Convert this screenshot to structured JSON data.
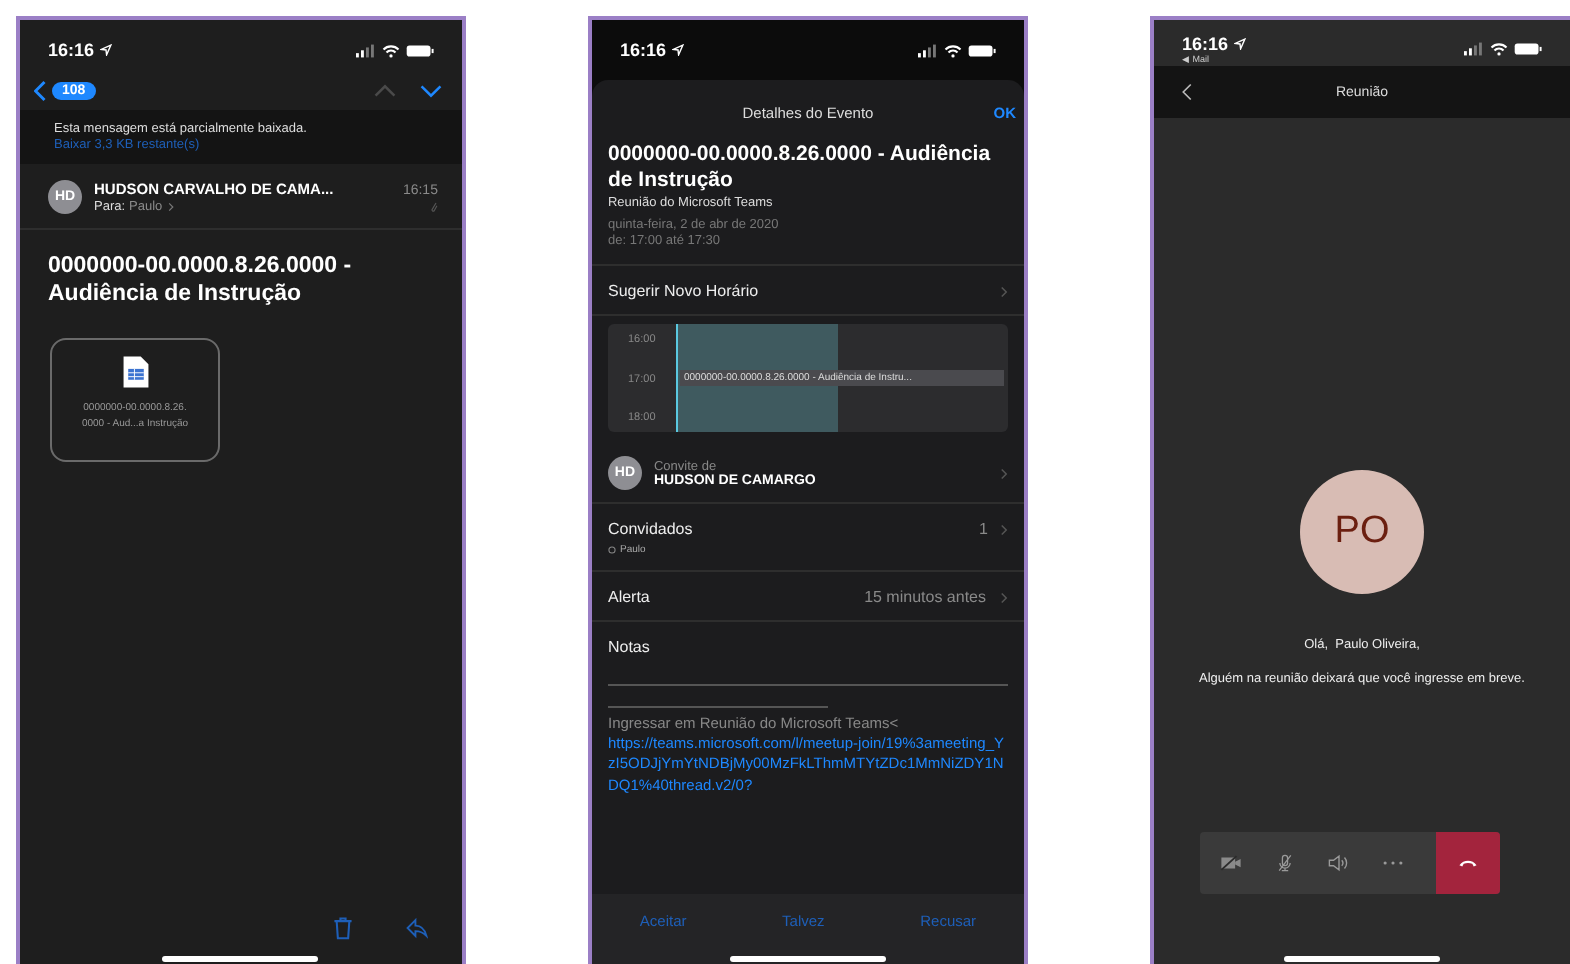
{
  "mail": {
    "status_time": "16:16",
    "unread_badge": "108",
    "notice": "Esta mensagem está parcialmente baixada.",
    "download_link": "Baixar 3,3 KB restante(s)",
    "sender_initials": "HD",
    "sender": "HUDSON CARVALHO DE CAMA...",
    "received_time": "16:15",
    "to_label": "Para:",
    "to_name": "Paulo",
    "subject": "0000000-00.0000.8.26.0000 - Audiência de Instrução",
    "attachment_lines": [
      "0000000-00.0000.8.26.",
      "0000 - Aud...a Instrução"
    ]
  },
  "event": {
    "status_time": "16:16",
    "header_title": "Detalhes do Evento",
    "ok_button": "OK",
    "title": "0000000-00.0000.8.26.0000 - Audiência de Instrução",
    "subtitle": "Reunião do Microsoft Teams",
    "date": "quinta-feira, 2 de abr de 2020",
    "time_range": "de: 17:00 até 17:30",
    "suggest_row": "Sugerir Novo Horário",
    "calendar": {
      "hours": [
        "16:00",
        "17:00",
        "18:00"
      ],
      "event_label": "0000000-00.0000.8.26.0000 - Audiência de Instru..."
    },
    "organizer": {
      "initials": "HD",
      "caption": "Convite de",
      "name": "HUDSON DE CAMARGO"
    },
    "invitees": {
      "label": "Convidados",
      "count": "1",
      "names": [
        "Paulo"
      ]
    },
    "alert": {
      "label": "Alerta",
      "value": "15 minutos antes"
    },
    "notes_label": "Notas",
    "notes_text": "Ingressar em Reunião do Microsoft Teams<",
    "notes_link": "https://teams.microsoft.com/l/meetup-join/19%3ameeting_YzI5ODJjYmYtNDBjMy00MzFkLThmMTYtZDc1MmNiZDY1NDQ1%40thread.v2/0?",
    "actions": [
      "Aceitar",
      "Talvez",
      "Recusar"
    ]
  },
  "call": {
    "status_time": "16:16",
    "back_app": "◀ Mail",
    "title": "Reunião",
    "avatar_initials": "PO",
    "greeting": "Olá,  Paulo Oliveira,",
    "message": "Alguém na reunião deixará que você ingresse em breve.",
    "controls": [
      {
        "kind": "camera-off"
      },
      {
        "kind": "mic-off"
      },
      {
        "kind": "speaker"
      },
      {
        "kind": "more"
      },
      {
        "kind": "hang-up"
      }
    ]
  }
}
